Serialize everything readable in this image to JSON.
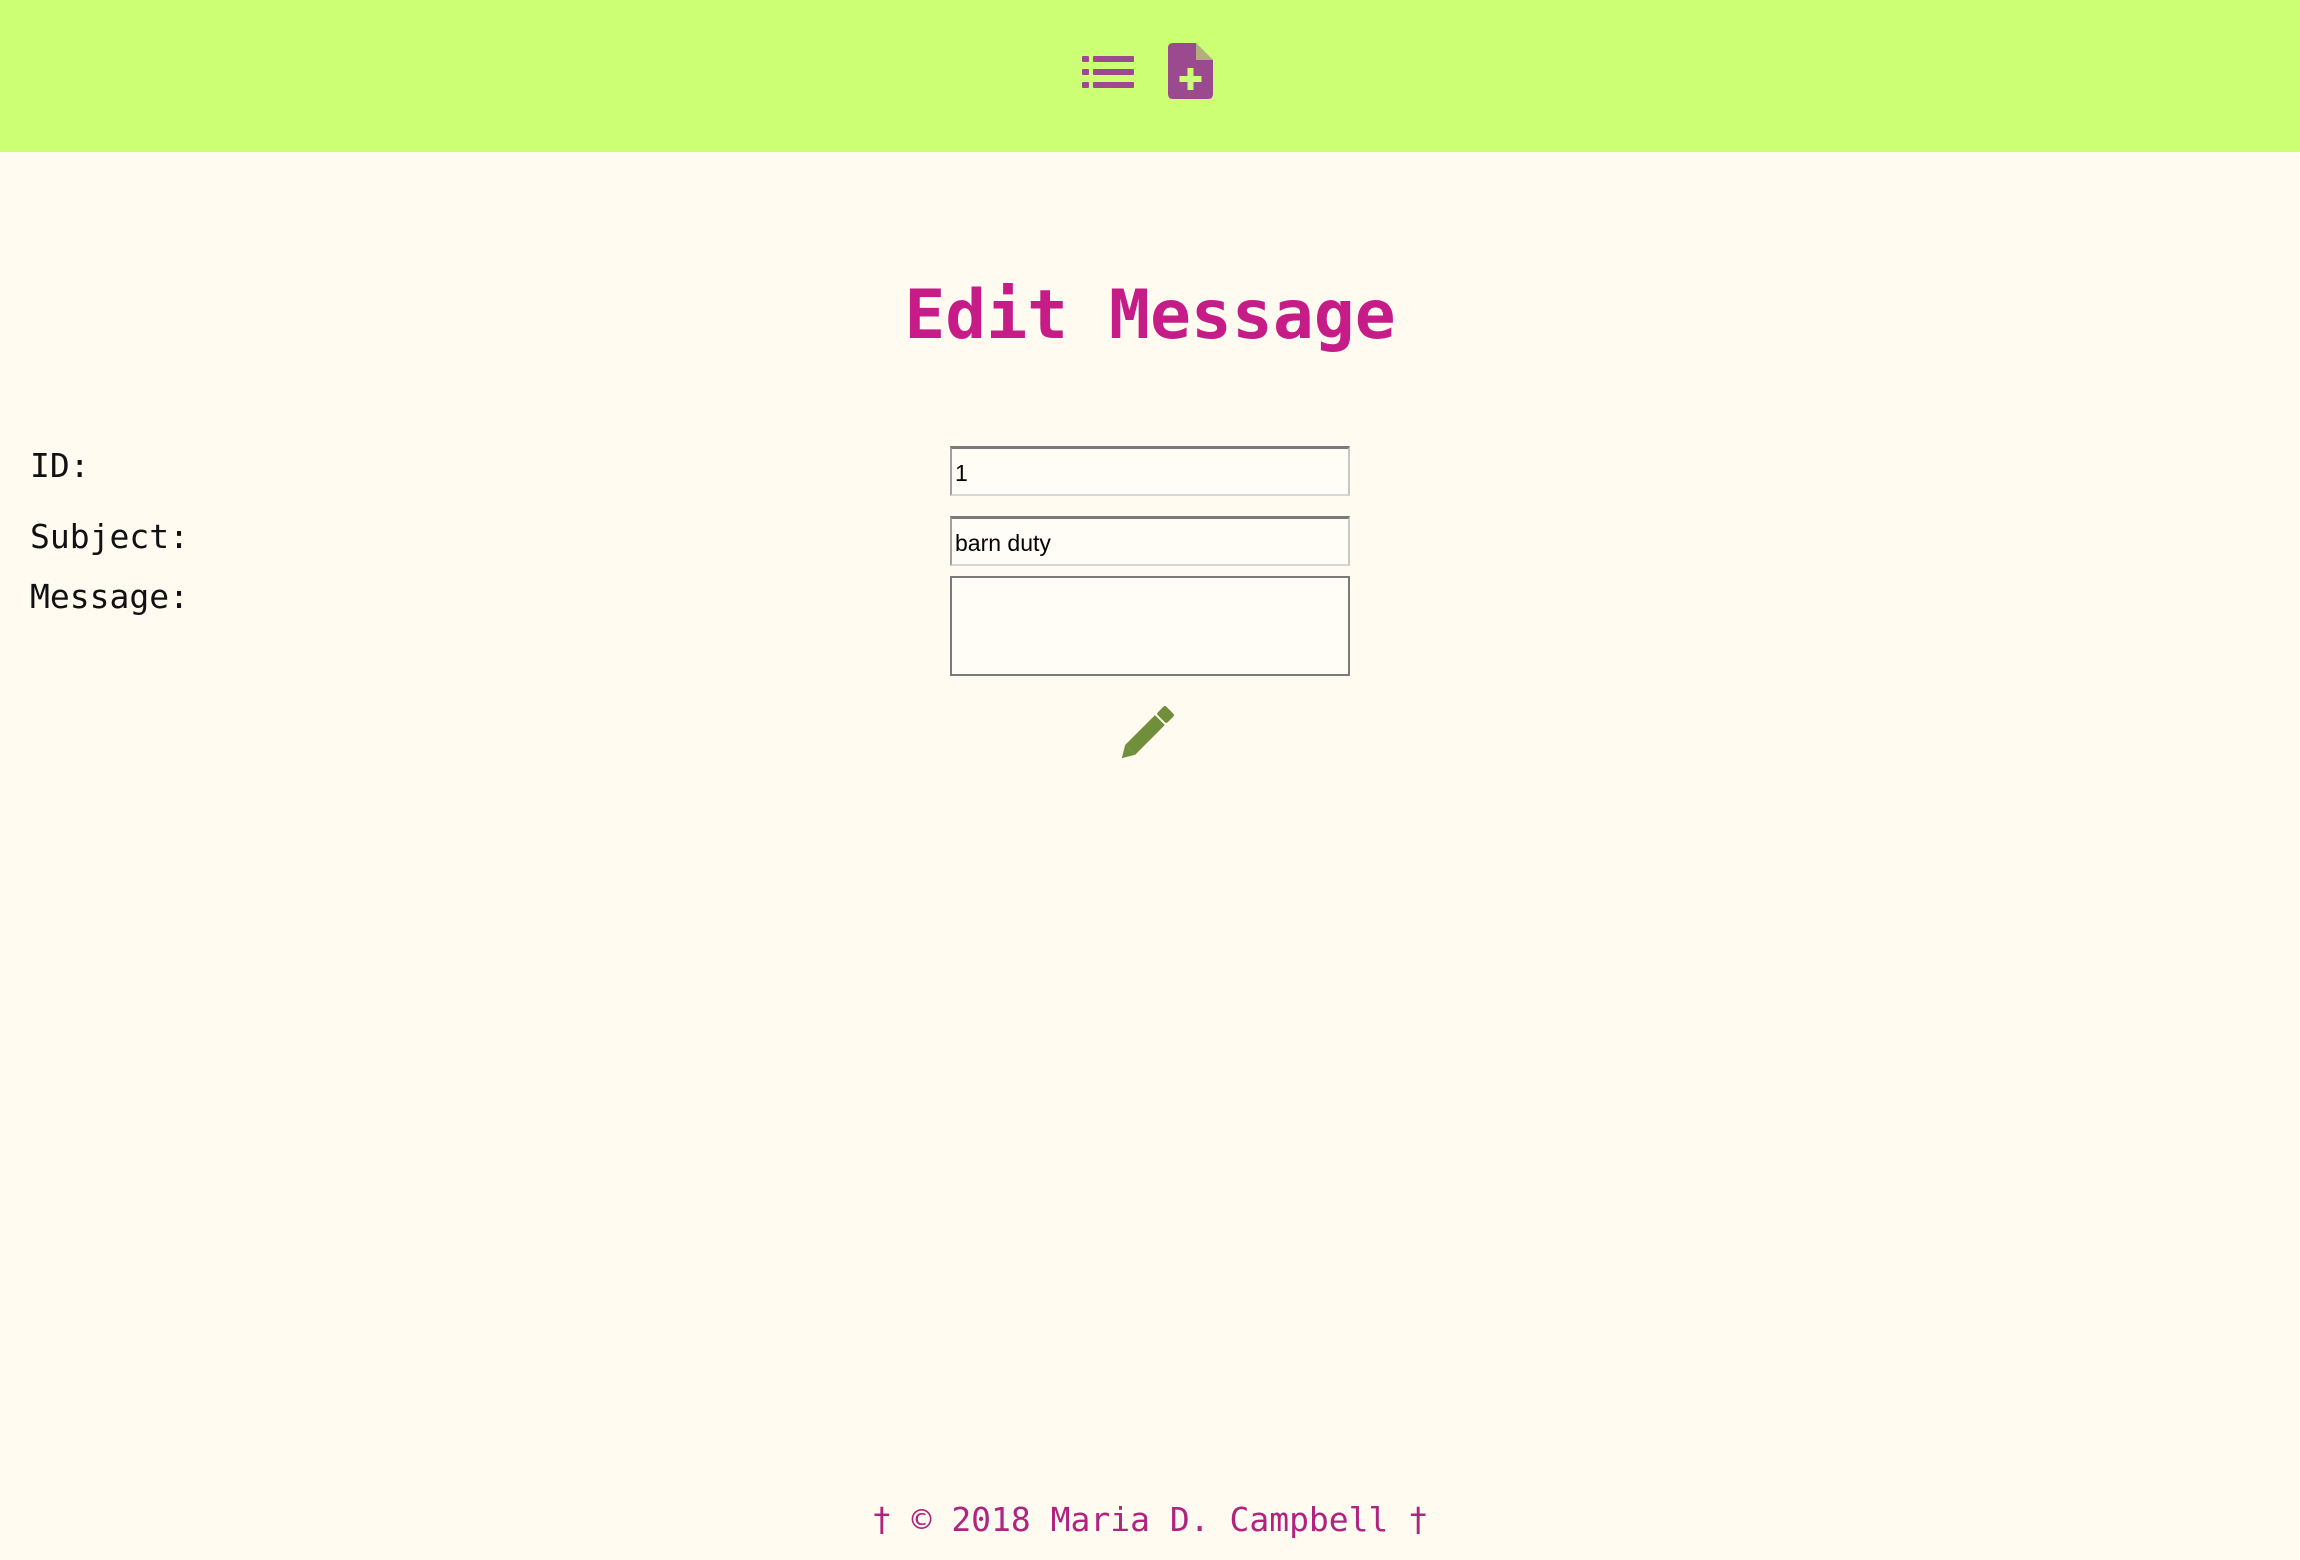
{
  "nav": {
    "list_icon": "list-icon",
    "new_icon": "file-plus-icon"
  },
  "page": {
    "title": "Edit Message"
  },
  "form": {
    "id_label": "ID:",
    "id_value": "1",
    "subject_label": "Subject:",
    "subject_value": "barn duty",
    "message_label": "Message:",
    "message_value": "",
    "submit_icon": "pencil-icon"
  },
  "footer": {
    "text": "† © 2018 Maria D. Campbell †"
  },
  "colors": {
    "header_bg": "#ccff73",
    "page_bg": "#fffbf0",
    "title": "#c51c87",
    "icon_purple": "#9b4a8f",
    "pencil_green": "#6f8f3a"
  }
}
